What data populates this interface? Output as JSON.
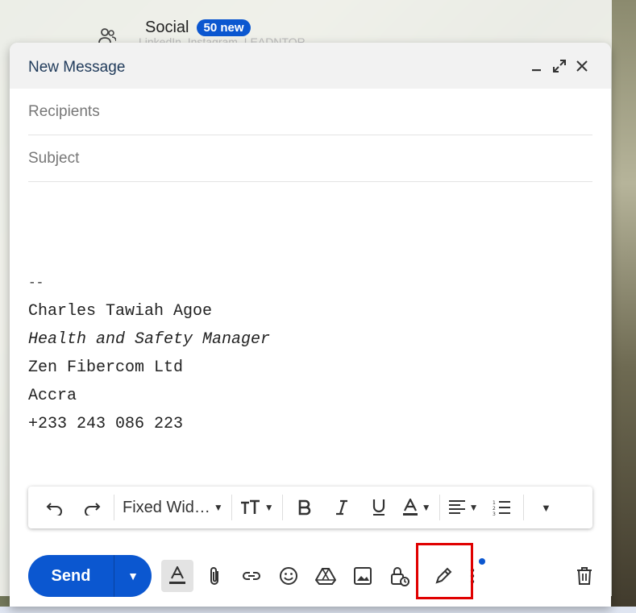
{
  "background": {
    "social_label": "Social",
    "social_badge": "50 new",
    "social_sub": "LinkedIn, Instagram, LEADNTOR"
  },
  "compose": {
    "title": "New Message",
    "recipients_placeholder": "Recipients",
    "subject_placeholder": "Subject",
    "signature": {
      "dash": "--",
      "name": "Charles Tawiah Agoe",
      "role": "Health and Safety Manager",
      "company": "Zen Fibercom Ltd",
      "city": "Accra",
      "phone": "+233 243 086 223"
    }
  },
  "format_bar": {
    "font_name": "Fixed Wid…"
  },
  "action_bar": {
    "send_label": "Send"
  },
  "icons": {
    "minimize": "minimize-icon",
    "popout": "popout-icon",
    "close": "close-icon",
    "highlight_color": "#e00000",
    "accent": "#0b57d0"
  }
}
